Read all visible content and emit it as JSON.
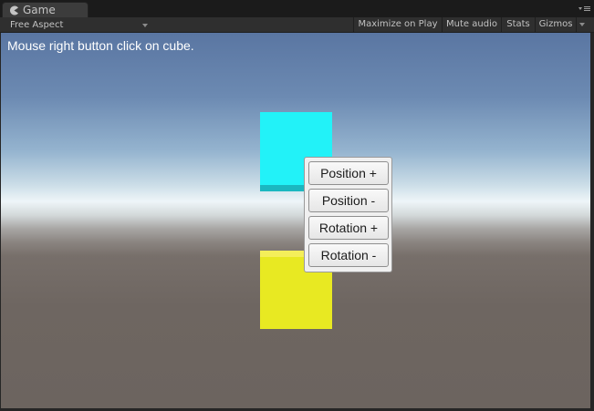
{
  "tab": {
    "title": "Game",
    "icon": "pacman-icon"
  },
  "toolbar": {
    "aspect": "Free Aspect",
    "maximize_on_play": "Maximize on Play",
    "mute_audio": "Mute audio",
    "stats": "Stats",
    "gizmos": "Gizmos"
  },
  "viewport": {
    "instruction": "Mouse right button click on cube.",
    "cube_colors": {
      "top_cube": "#22f2f8",
      "bottom_cube": "#e8e922"
    }
  },
  "context_menu": {
    "items": [
      {
        "label": "Position +"
      },
      {
        "label": "Position -"
      },
      {
        "label": "Rotation +"
      },
      {
        "label": "Rotation -"
      }
    ]
  }
}
